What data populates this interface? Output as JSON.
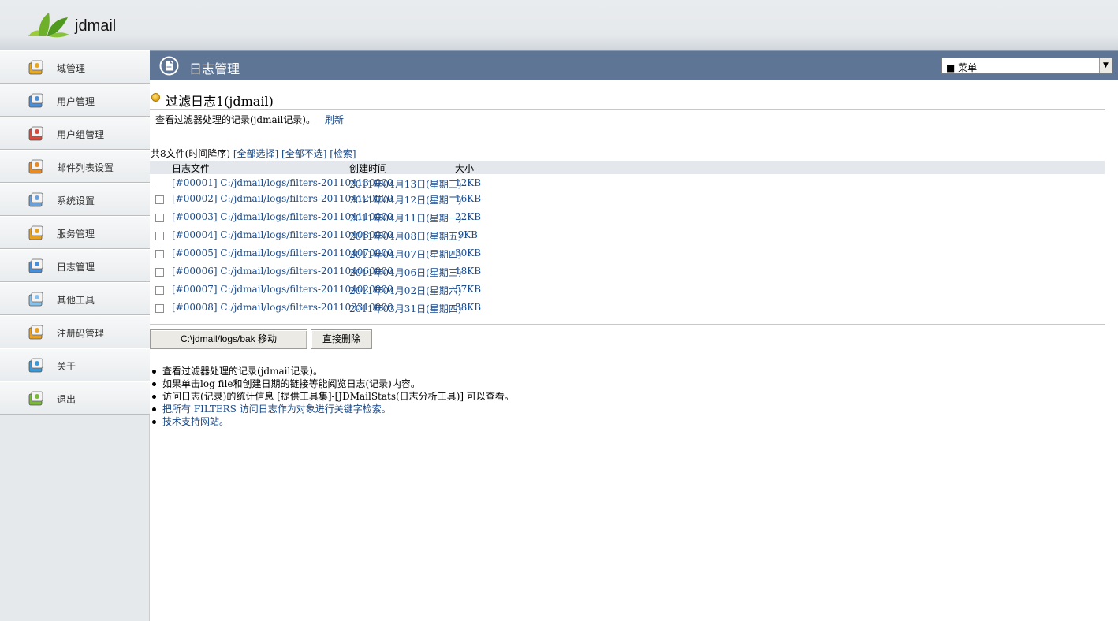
{
  "header": {
    "brand": "jdmail"
  },
  "sidebar": {
    "items": [
      {
        "label": "域管理",
        "icon": "domain-icon"
      },
      {
        "label": "用户管理",
        "icon": "user-icon"
      },
      {
        "label": "用户组管理",
        "icon": "user-group-icon"
      },
      {
        "label": "邮件列表设置",
        "icon": "mailing-list-icon"
      },
      {
        "label": "系统设置",
        "icon": "system-settings-icon"
      },
      {
        "label": "服务管理",
        "icon": "service-icon"
      },
      {
        "label": "日志管理",
        "icon": "log-icon"
      },
      {
        "label": "其他工具",
        "icon": "tools-icon"
      },
      {
        "label": "注册码管理",
        "icon": "license-icon"
      },
      {
        "label": "关于",
        "icon": "about-icon"
      },
      {
        "label": "退出",
        "icon": "logout-icon"
      }
    ]
  },
  "titlebar": {
    "title": "日志管理",
    "menu_value": "■ 菜单"
  },
  "section": {
    "title": "过滤日志1(jdmail)",
    "description": "查看过滤器处理的记录(jdmail记录)。",
    "refresh": "刷新"
  },
  "file_list": {
    "count_text": "共8文件(时间降序)",
    "select_all": "[全部选择]",
    "deselect_all": "[全部不选]",
    "search": "[检索]",
    "headers": {
      "file": "日志文件",
      "created": "创建时间",
      "size": "大小"
    },
    "rows": [
      {
        "file": "[#00001] C:/jdmail/logs/filters-201104130000",
        "date": "2011年04月13日(星期三)",
        "size": "12KB",
        "checkbox": false
      },
      {
        "file": "[#00002] C:/jdmail/logs/filters-201104120000",
        "date": "2011年04月12日(星期二)",
        "size": "16KB",
        "checkbox": true
      },
      {
        "file": "[#00003] C:/jdmail/logs/filters-201104110000",
        "date": "2011年04月11日(星期一)",
        "size": "22KB",
        "checkbox": true
      },
      {
        "file": "[#00004] C:/jdmail/logs/filters-201104080000",
        "date": "2011年04月08日(星期五)",
        "size": "9KB",
        "checkbox": true
      },
      {
        "file": "[#00005] C:/jdmail/logs/filters-201104070000",
        "date": "2011年04月07日(星期四)",
        "size": "30KB",
        "checkbox": true
      },
      {
        "file": "[#00006] C:/jdmail/logs/filters-201104060000",
        "date": "2011年04月06日(星期三)",
        "size": "18KB",
        "checkbox": true
      },
      {
        "file": "[#00007] C:/jdmail/logs/filters-201104020000",
        "date": "2011年04月02日(星期六)",
        "size": "57KB",
        "checkbox": true
      },
      {
        "file": "[#00008] C:/jdmail/logs/filters-201103310000",
        "date": "2011年03月31日(星期四)",
        "size": "38KB",
        "checkbox": true
      }
    ],
    "first_row_marker": "-"
  },
  "actions": {
    "move": "C:\\jdmail/logs/bak 移动",
    "delete": "直接删除"
  },
  "notes": [
    {
      "text": "查看过滤器处理的记录(jdmail记录)。",
      "link": false
    },
    {
      "text": "如果单击log file和创建日期的链接等能阅览日志(记录)内容。",
      "link": false
    },
    {
      "text": "访问日志(记录)的统计信息 [提供工具集]-[JDMailStats(日志分析工具)] 可以查看。",
      "link": false
    },
    {
      "text": "把所有  FILTERS 访问日志作为对象进行关键字检索。",
      "link": true
    },
    {
      "text": "技术支持网站。",
      "link": true
    }
  ],
  "colors": {
    "titlebar": "#5e7596",
    "link": "#1a4a8a",
    "sidebar": "#e6e9ec"
  }
}
